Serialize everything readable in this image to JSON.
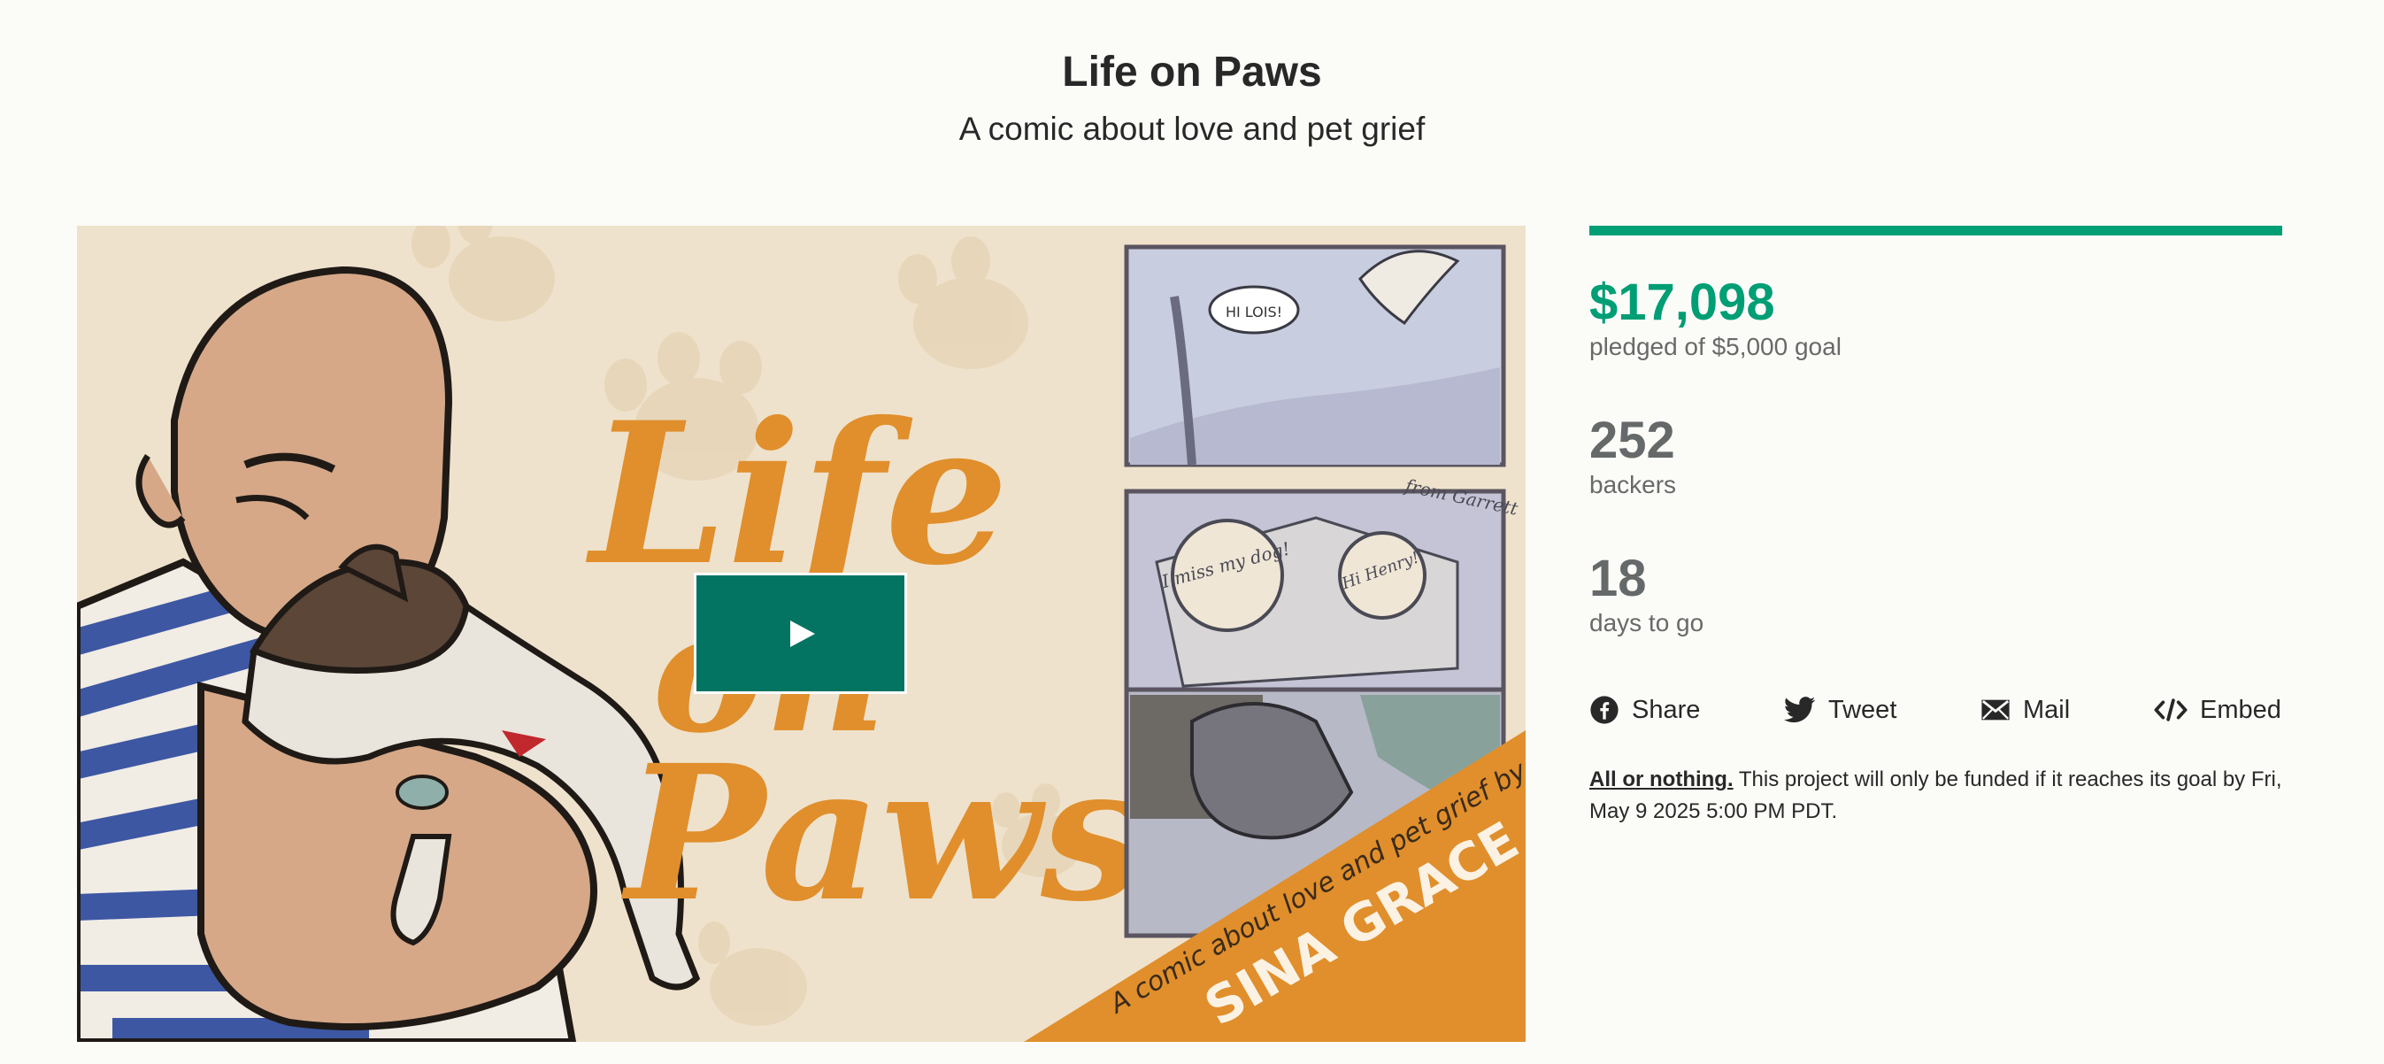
{
  "project": {
    "title": "Life on Paws",
    "subtitle": "A comic about love and pet grief"
  },
  "media": {
    "cover_title": "Life on Paws",
    "cover_tagline": "A comic about love and pet grief by",
    "cover_author": "SINA GRACE",
    "panel_speech": "HI LOIS!",
    "panel_note": "from Garrett",
    "panel_cake_1": "I miss my dog!",
    "panel_cake_2": "Hi Henry!",
    "play_icon": "play-icon"
  },
  "stats": {
    "funded_fraction": 1.0,
    "pledged_amount": "$17,098",
    "pledged_label": "pledged of $5,000 goal",
    "backers_count": "252",
    "backers_label": "backers",
    "days_count": "18",
    "days_label": "days to go"
  },
  "share": [
    {
      "label": "Share",
      "icon": "facebook-icon"
    },
    {
      "label": "Tweet",
      "icon": "twitter-icon"
    },
    {
      "label": "Mail",
      "icon": "mail-icon"
    },
    {
      "label": "Embed",
      "icon": "embed-icon"
    }
  ],
  "funding": {
    "model_label": "All or nothing.",
    "description": " This project will only be funded if it reaches its goal by Fri, May 9 2025 5:00 PM PDT."
  },
  "colors": {
    "accent": "#009e74",
    "play_button": "#037362",
    "cover_orange": "#e08f2c",
    "stripe_blue": "#3d57a3"
  }
}
